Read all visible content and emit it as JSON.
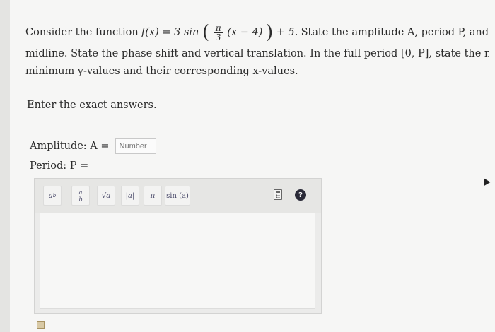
{
  "question": {
    "line1_prefix": "Consider the function",
    "func_lhs": "f(x) = 3 sin",
    "frac_num": "π",
    "frac_den": "3",
    "inner": "(x − 4)",
    "plus": "+ 5.",
    "line1_suffix": "State the amplitude A, period P, and",
    "line2": "midline. State the phase shift and vertical translation. In the full period [0, P], state the maximum and",
    "line3": "minimum y-values and their corresponding x-values."
  },
  "instruction": "Enter the exact answers.",
  "amplitude": {
    "label": "Amplitude: A =",
    "placeholder": "Number"
  },
  "period": {
    "label": "Period: P ="
  },
  "toolbar": {
    "power_base": "a",
    "power_exp": "b",
    "frac_num": "a",
    "frac_den": "b",
    "sqrt": "√a",
    "abs": "|a|",
    "pi": "π",
    "sin": "sin (a)",
    "keypad_icon": "keypad-icon",
    "help": "?"
  }
}
